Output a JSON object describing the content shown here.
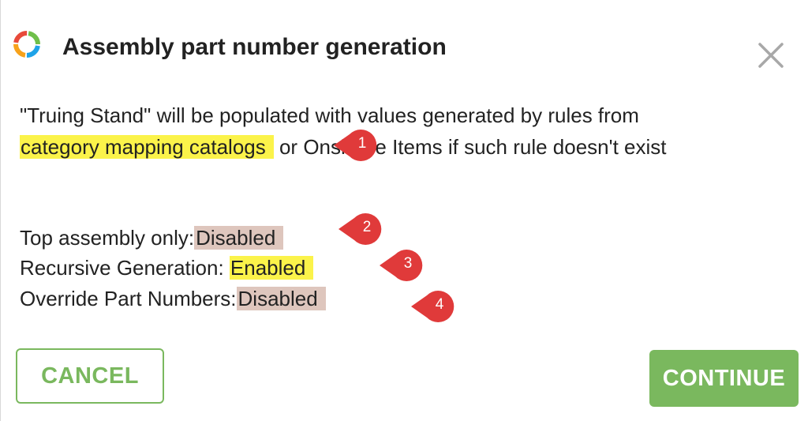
{
  "dialog": {
    "title": "Assembly part number generation",
    "message_line1": "\"Truing Stand\" will be populated with values generated by rules from",
    "message_line2_highlight": "category mapping catalogs",
    "message_line2_rest": " or Onshape Items if such rule doesn't exist"
  },
  "settings": [
    {
      "label": "Top assembly only:",
      "value": "Disabled",
      "highlight": "#dec6bd"
    },
    {
      "label": "Recursive Generation:",
      "value": "Enabled",
      "highlight": "#fbf34a"
    },
    {
      "label": "Override Part Numbers:",
      "value": "Disabled",
      "highlight": "#dec6bd"
    }
  ],
  "annotations": [
    "1",
    "2",
    "3",
    "4"
  ],
  "buttons": {
    "cancel": "CANCEL",
    "continue": "CONTINUE"
  },
  "colors": {
    "accent_green": "#7ab85e",
    "annotation_red": "#e03a3a",
    "highlight_yellow": "#fbf34a",
    "highlight_tan": "#dec6bd"
  }
}
